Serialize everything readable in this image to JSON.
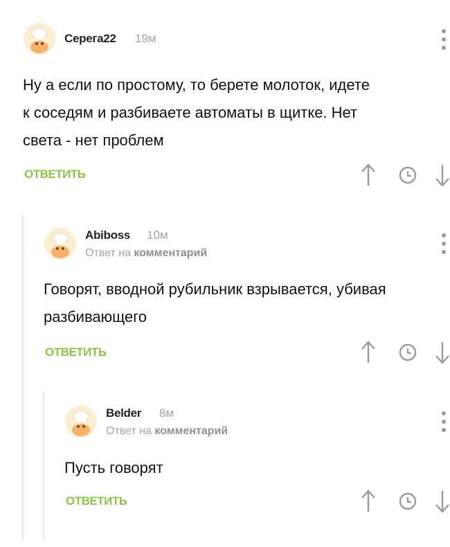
{
  "colors": {
    "accent_green": "#8bc34a",
    "muted_text": "#a3a3a3",
    "icon_gray": "#9a9a9a",
    "thread_line": "#e5e5e5"
  },
  "comments": [
    {
      "author": "Серега22",
      "time": "19м",
      "reply_prefix": "",
      "reply_link": "",
      "text": "Ну а если по простому, то берете молоток, идете\nк соседям и разбиваете автоматы в щитке. Нет\nсвета - нет проблем",
      "reply_label": "ОТВЕТИТЬ",
      "icons": [
        "arrow-up-icon",
        "clock-icon",
        "arrow-down-icon",
        "more-vertical-icon",
        "avatar-icon"
      ]
    },
    {
      "author": "Abiboss",
      "time": "10м",
      "reply_prefix": "Ответ на",
      "reply_link": "комментарий",
      "text": "Говорят, вводной рубильник взрывается, убивая\nразбивающего",
      "reply_label": "ОТВЕТИТЬ",
      "icons": [
        "arrow-up-icon",
        "clock-icon",
        "arrow-down-icon",
        "more-vertical-icon",
        "avatar-icon"
      ]
    },
    {
      "author": "Belder",
      "time": "8м",
      "reply_prefix": "Ответ на",
      "reply_link": "комментарий",
      "text": "Пусть говорят",
      "reply_label": "ОТВЕТИТЬ",
      "icons": [
        "arrow-up-icon",
        "clock-icon",
        "arrow-down-icon",
        "more-vertical-icon",
        "avatar-icon"
      ]
    }
  ]
}
